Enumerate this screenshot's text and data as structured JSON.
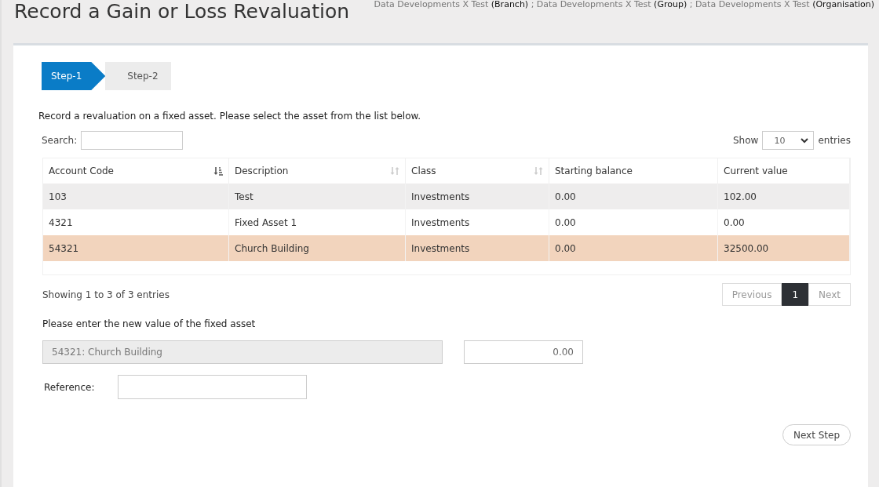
{
  "page": {
    "title": "Record a Gain or Loss Revaluation",
    "context": "Data Developments X Test **(Branch)** ; Data Developments X Test **(Group)** ; Data Developments X Test **(Organisation)**"
  },
  "steps": [
    {
      "label": "Step-1",
      "selected": true
    },
    {
      "label": "Step-2",
      "selected": false
    }
  ],
  "intro": "Record a revaluation on a fixed asset. Please select the asset from the list below.",
  "search": {
    "label": "Search:"
  },
  "length": {
    "before": "Show",
    "value": "10",
    "after": "entries"
  },
  "table": {
    "columns": [
      {
        "label": "Account Code",
        "kind": "sortable",
        "sorted": true
      },
      {
        "label": "Description",
        "kind": "sortable",
        "sorted": false
      },
      {
        "label": "Class",
        "kind": "sortable",
        "sorted": false
      },
      {
        "label": "Starting balance",
        "kind": "plain"
      },
      {
        "label": "Current value",
        "kind": "plain"
      }
    ],
    "rows": [
      {
        "cells": [
          "103",
          "Test",
          "Investments",
          "0.00",
          "102.00"
        ],
        "selected": false
      },
      {
        "cells": [
          "4321",
          "Fixed Asset 1",
          "Investments",
          "0.00",
          "0.00"
        ],
        "selected": false
      },
      {
        "cells": [
          "54321",
          "Church Building",
          "Investments",
          "0.00",
          "32500.00"
        ],
        "selected": true
      }
    ]
  },
  "info": "Showing 1 to 3 of 3 entries",
  "pagination": [
    {
      "label": "Previous",
      "selected": false
    },
    {
      "label": "1",
      "selected": true
    },
    {
      "label": "Next",
      "selected": false
    }
  ],
  "form": {
    "heading": "Please enter the new value of the fixed asset",
    "asset": "54321: Church Building",
    "amount": "0.00",
    "reference_label": "Reference:"
  },
  "next_button": "Next Step"
}
